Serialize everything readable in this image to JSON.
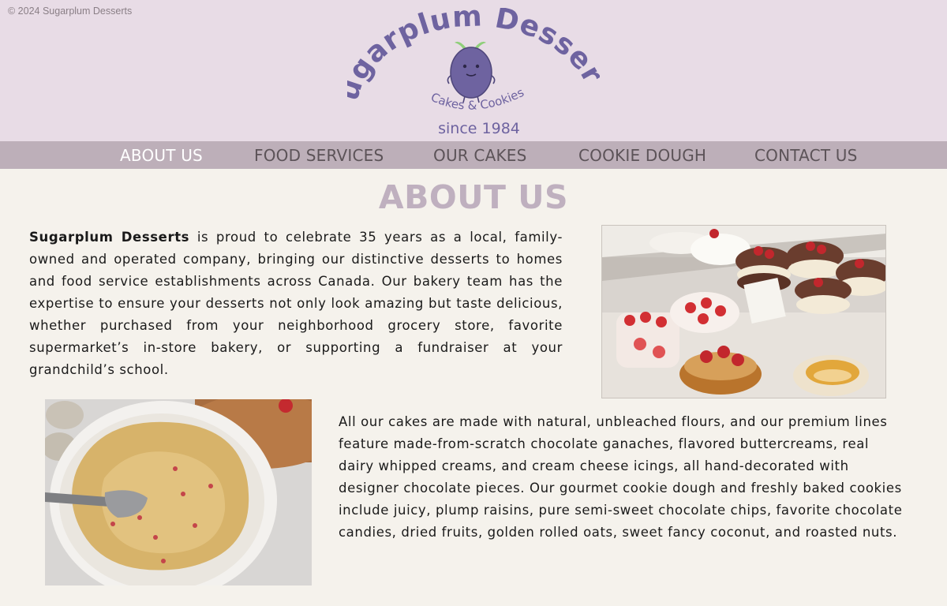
{
  "header": {
    "copyright": "© 2024 Sugarplum Desserts",
    "logo": {
      "brand_name": "Sugarplum Desserts",
      "tagline": "Cakes & Cookies",
      "icon": "plum-mascot-icon"
    },
    "since": "since 1984"
  },
  "nav": {
    "items": [
      {
        "label": "ABOUT US",
        "active": true
      },
      {
        "label": "FOOD SERVICES",
        "active": false
      },
      {
        "label": "OUR CAKES",
        "active": false
      },
      {
        "label": "COOKIE DOUGH",
        "active": false
      },
      {
        "label": "CONTACT US",
        "active": false
      }
    ]
  },
  "main": {
    "title": "ABOUT US",
    "intro_brand": "Sugarplum Desserts",
    "intro_text": " is proud to celebrate 35 years as a local, family-owned and operated company, bringing our distinctive desserts to homes and food service establishments across Canada. Our bakery team has the expertise to ensure your desserts not only look amazing but taste delicious, whether purchased from your neighborhood grocery store, favorite supermarket’s in-store bakery, or supporting a fundraiser at your grandchild’s school.",
    "body_text": "All our cakes are made with natural, unbleached flours, and our premium lines feature made-from-scratch chocolate ganaches, flavored buttercreams, real dairy whipped creams, and cream cheese icings, all hand-decorated with designer chocolate pieces. Our gourmet cookie dough and freshly baked cookies include juicy, plump raisins, pure semi-sweet chocolate chips, favorite chocolate candies, dried fruits, golden rolled oats, sweet fancy coconut, and roasted nuts."
  },
  "colors": {
    "header_bg": "#e8dce6",
    "nav_bg": "#bdafb9",
    "page_bg": "#f5f2ec",
    "brand_purple": "#6e63a0",
    "title_color": "#bfb0bf"
  }
}
